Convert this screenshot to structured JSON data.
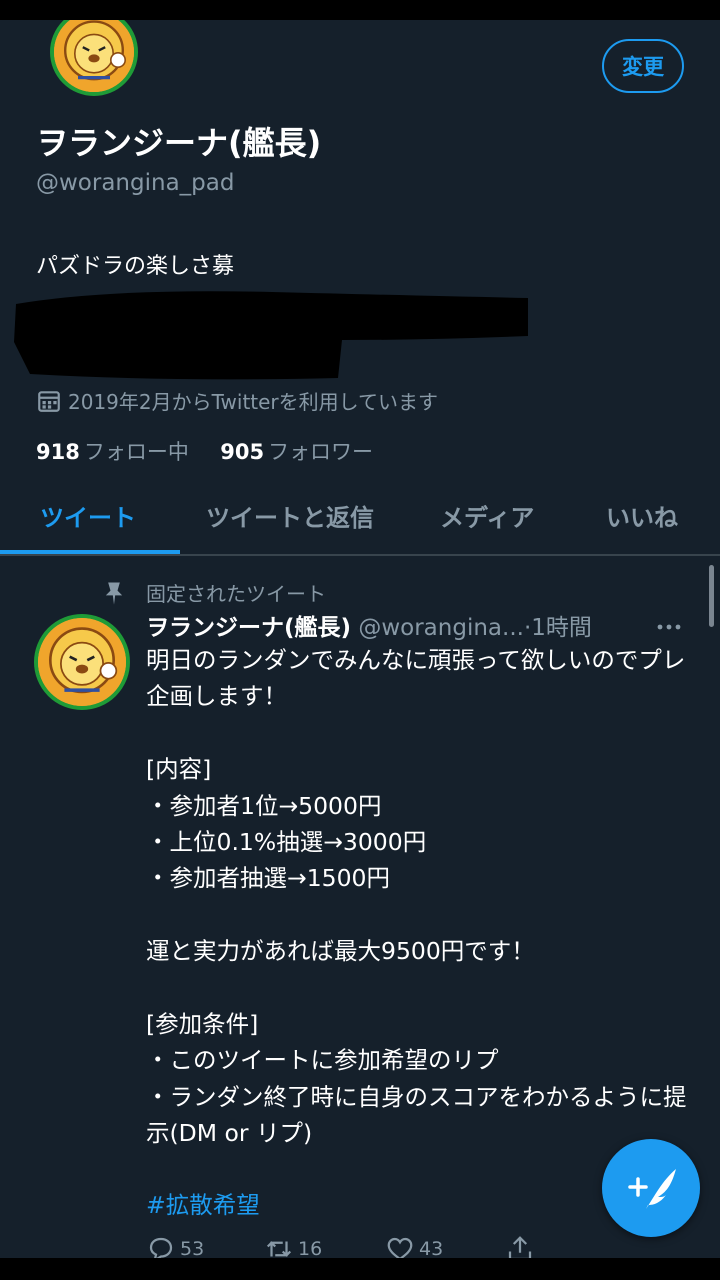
{
  "profile": {
    "display_name": "ヲランジーナ(艦長)",
    "handle": "@worangina_pad",
    "bio": "パズドラの楽しさ募",
    "joined": "2019年2月からTwitterを利用しています",
    "following_count": "918",
    "following_label": "フォロー中",
    "followers_count": "905",
    "followers_label": "フォロワー",
    "edit_button": "変更"
  },
  "tabs": [
    {
      "label": "ツイート",
      "active": true
    },
    {
      "label": "ツイートと返信",
      "active": false
    },
    {
      "label": "メディア",
      "active": false
    },
    {
      "label": "いいね",
      "active": false
    }
  ],
  "tweet": {
    "pinned_label": "固定されたツイート",
    "author_name": "ヲランジーナ(艦長)",
    "author_handle": "@worangina...",
    "separator": "·",
    "time": "1時間",
    "body": "明日のランダンでみんなに頑張って欲しいのでプレ企画します！\n\n[内容]\n・参加者1位→5000円\n・上位0.1%抽選→3000円\n・参加者抽選→1500円\n\n運と実力があれば最大9500円です！\n\n[参加条件]\n・このツイートに参加希望のリプ\n・ランダン終了時に自身のスコアをわかるように提示(DM or リプ)",
    "hashtag": "#拡散希望",
    "reply_count": "53",
    "retweet_count": "16",
    "like_count": "43"
  },
  "icons": {
    "calendar": "calendar-icon",
    "pin": "pin-icon",
    "more": "more-icon",
    "reply": "reply-icon",
    "retweet": "retweet-icon",
    "like": "like-icon",
    "share": "share-icon",
    "compose": "compose-icon"
  },
  "colors": {
    "background": "#15202b",
    "accent": "#1d9bf0",
    "secondary_text": "#8899a6",
    "divider": "#38444d"
  }
}
